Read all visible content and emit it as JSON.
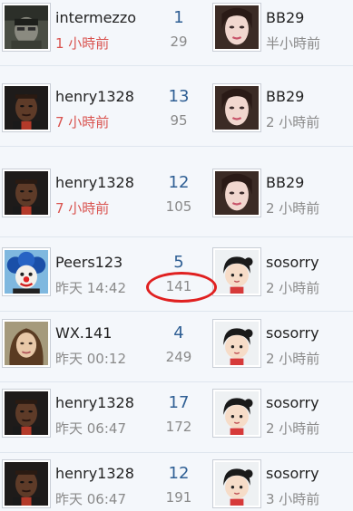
{
  "rows": [
    {
      "user": "intermezzo",
      "time": "1 小時前",
      "replies": "1",
      "views": "29",
      "last_user": "BB29",
      "last_time": "半小時前",
      "time_color": "#d9534f",
      "avatar": "soldier-avatar",
      "last_avatar": "woman-avatar"
    },
    {
      "user": "henry1328",
      "time": "7 小時前",
      "replies": "13",
      "views": "95",
      "last_user": "BB29",
      "last_time": "2 小時前",
      "time_color": "#d9534f",
      "avatar": "man-avatar",
      "last_avatar": "woman-avatar"
    },
    {
      "user": "henry1328",
      "time": "7 小時前",
      "replies": "12",
      "views": "105",
      "last_user": "BB29",
      "last_time": "2 小時前",
      "time_color": "#d9534f",
      "avatar": "man-avatar",
      "last_avatar": "woman-avatar"
    },
    {
      "user": "Peers123",
      "time": "昨天 14:42",
      "replies": "5",
      "views": "141",
      "last_user": "sosorry",
      "last_time": "2 小時前",
      "time_color": "#8a8a8a",
      "avatar": "clown-avatar",
      "last_avatar": "cartoon-girl-avatar"
    },
    {
      "user": "WX.141",
      "time": "昨天 00:12",
      "replies": "4",
      "views": "249",
      "last_user": "sosorry",
      "last_time": "2 小時前",
      "time_color": "#8a8a8a",
      "avatar": "woman-brown-hair-avatar",
      "last_avatar": "cartoon-girl-avatar"
    },
    {
      "user": "henry1328",
      "time": "昨天 06:47",
      "replies": "17",
      "views": "172",
      "last_user": "sosorry",
      "last_time": "2 小時前",
      "time_color": "#8a8a8a",
      "avatar": "man-avatar",
      "last_avatar": "cartoon-girl-avatar"
    },
    {
      "user": "henry1328",
      "time": "昨天 06:47",
      "replies": "12",
      "views": "191",
      "last_user": "sosorry",
      "last_time": "3 小時前",
      "time_color": "#8a8a8a",
      "avatar": "man-avatar",
      "last_avatar": "cartoon-girl-avatar"
    }
  ],
  "highlight": {
    "row": 3,
    "field": "views",
    "color": "#e02020"
  }
}
